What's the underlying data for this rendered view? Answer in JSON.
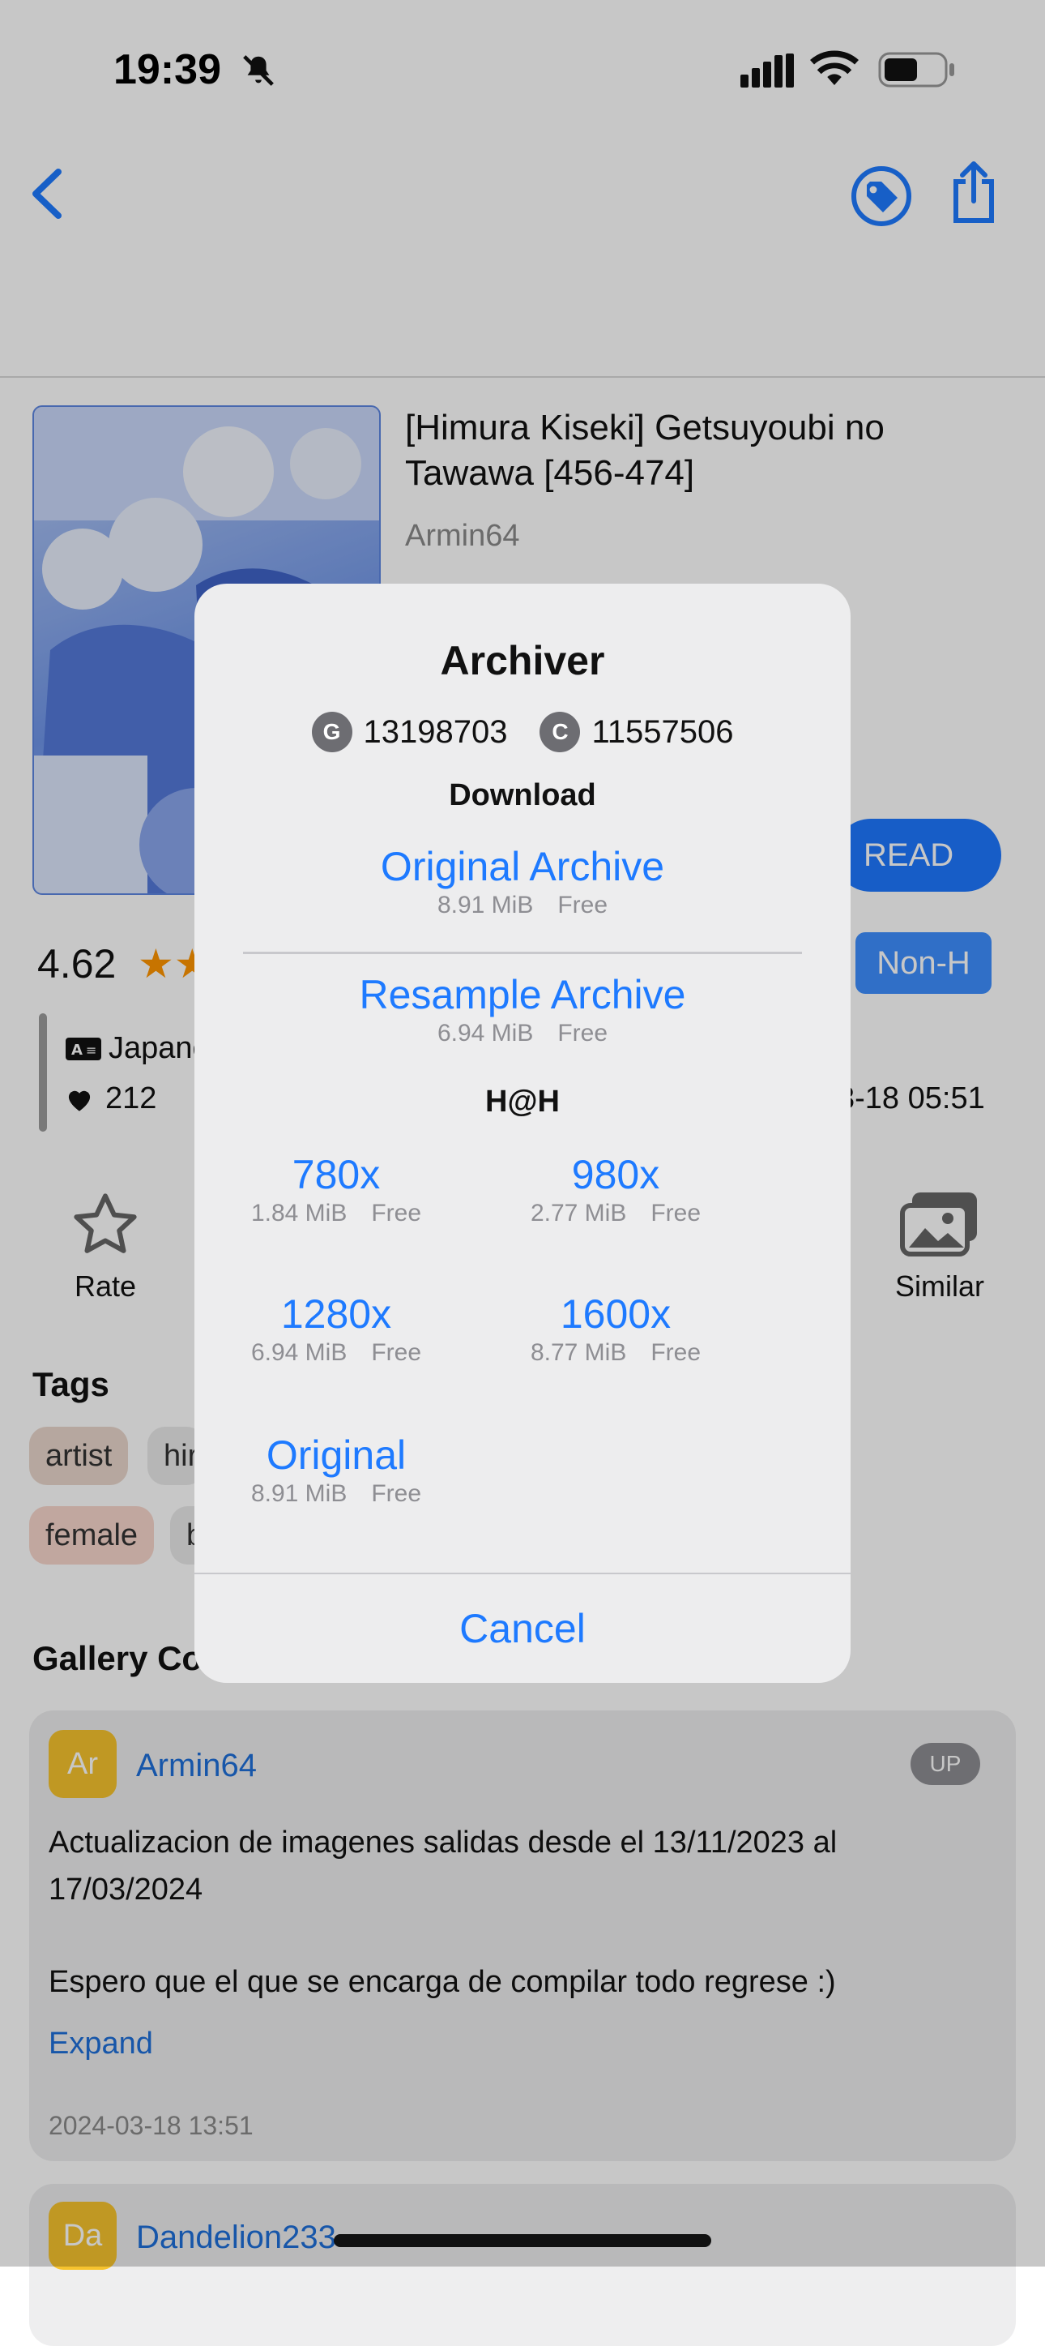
{
  "status_bar": {
    "time": "19:39"
  },
  "gallery": {
    "title": "[Himura Kiseki] Getsuyoubi no Tawawa [456-474]",
    "uploader": "Armin64",
    "read_label": "READ",
    "category": "Non-H",
    "rating": "4.62",
    "language": "Japane",
    "favorites": "212",
    "posted": "3-18 05:51"
  },
  "actions": {
    "rate": "Rate",
    "similar": "Similar"
  },
  "tags": {
    "title": "Tags",
    "rows": [
      {
        "namespace": "artist",
        "value": "hir"
      },
      {
        "namespace": "female",
        "value": "b"
      }
    ]
  },
  "comments": {
    "title": "Gallery Co",
    "items": [
      {
        "avatar": "Ar",
        "author": "Armin64",
        "badge": "UP",
        "text_line1": "Actualizacion de imagenes salidas desde el 13/11/2023 al 17/03/2024",
        "text_line2": "Espero que el que se encarga de compilar todo regrese :)",
        "expand": "Expand",
        "date": "2024-03-18 13:51"
      },
      {
        "avatar": "Da",
        "author": "Dandelion233"
      }
    ]
  },
  "dialog": {
    "title": "Archiver",
    "gp_letter": "G",
    "gp_value": "13198703",
    "credits_letter": "C",
    "credits_value": "11557506",
    "download_section": "Download",
    "archives": [
      {
        "name": "Original Archive",
        "size": "8.91 MiB",
        "cost": "Free"
      },
      {
        "name": "Resample Archive",
        "size": "6.94 MiB",
        "cost": "Free"
      }
    ],
    "hath_section": "H@H",
    "hath": [
      {
        "name": "780x",
        "size": "1.84 MiB",
        "cost": "Free"
      },
      {
        "name": "980x",
        "size": "2.77 MiB",
        "cost": "Free"
      },
      {
        "name": "1280x",
        "size": "6.94 MiB",
        "cost": "Free"
      },
      {
        "name": "1600x",
        "size": "8.77 MiB",
        "cost": "Free"
      },
      {
        "name": "Original",
        "size": "8.91 MiB",
        "cost": "Free"
      }
    ],
    "cancel": "Cancel"
  },
  "colors": {
    "accent": "#1e7aff",
    "star": "#ff9500",
    "dialog_bg": "#ededee"
  },
  "icons": [
    "back-icon",
    "tag-icon",
    "share-icon",
    "star-icon",
    "similar-images-icon",
    "heart-icon",
    "language-icon"
  ]
}
